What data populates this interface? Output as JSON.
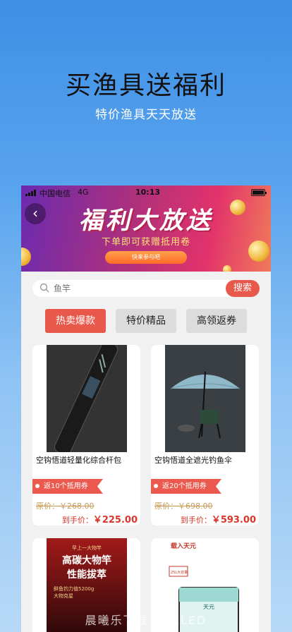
{
  "hero": {
    "title": "买渔具送福利",
    "subtitle": "特价渔具天天放送"
  },
  "statusbar": {
    "carrier": "中国电信",
    "network": "4G",
    "time": "10:13"
  },
  "banner": {
    "title": "福利大放送",
    "subtitle": "下单即可获赠抵用卷",
    "button": "快来参与吧"
  },
  "search": {
    "placeholder": "鱼竿",
    "button": "搜索"
  },
  "tabs": [
    {
      "label": "热卖爆款",
      "active": true
    },
    {
      "label": "特价精品",
      "active": false
    },
    {
      "label": "高领返券",
      "active": false
    }
  ],
  "products": [
    {
      "title": "空钩悟道轻量化综合杆包",
      "coupon": "返10个抵用券",
      "original_price": "原价：￥268.00",
      "final_label": "到手价：",
      "final_price": "￥225.00"
    },
    {
      "title": "空钩悟道全遮光钓鱼伞",
      "coupon": "返20个抵用券",
      "original_price": "原价：￥698.00",
      "final_label": "到手价：",
      "final_price": "￥593.00"
    }
  ],
  "partial_products": [
    {
      "lines": [
        "早上一大物竿",
        "高碳大物竿",
        "性能拔萃",
        "鲜鱼钓力值5200g",
        "大物克星"
      ]
    },
    {
      "lines": [
        "载入天元",
        "25L大容量",
        "天元"
      ]
    }
  ],
  "watermark": "晨曦乐下载 · FXLED"
}
